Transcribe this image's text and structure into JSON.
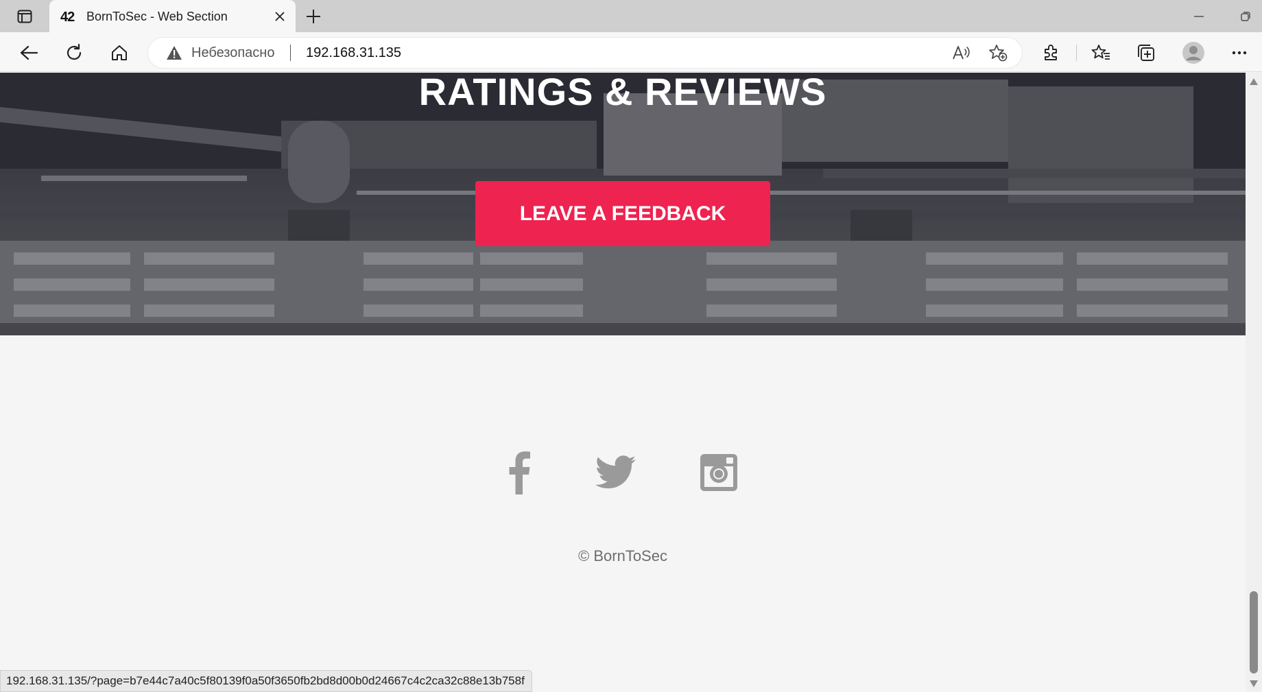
{
  "browser": {
    "tab": {
      "favicon": "42",
      "title": "BornToSec - Web Section"
    },
    "address_bar": {
      "security_label": "Небезопасно",
      "url": "192.168.31.135"
    },
    "status_bar_url": "192.168.31.135/?page=b7e44c7a40c5f80139f0a50f3650fb2bd8d00b0d24667c4c2ca32c88e13b758f",
    "icons": [
      "tab-actions-icon",
      "close-icon",
      "plus-icon",
      "minimize-icon",
      "maximize-icon",
      "back-icon",
      "reload-icon",
      "home-icon",
      "warning-icon",
      "read-aloud-icon",
      "add-favorite-icon",
      "extensions-icon",
      "favorites-icon",
      "collections-icon",
      "profile-icon",
      "more-icon"
    ]
  },
  "page": {
    "hero": {
      "title": "RATINGS & REVIEWS",
      "button_label": "LEAVE A FEEDBACK"
    },
    "socials": [
      "facebook-icon",
      "twitter-icon",
      "instagram-icon"
    ],
    "footer": {
      "copyright": "© BornToSec"
    }
  },
  "colors": {
    "accent": "#ee2350",
    "social_icon": "#9a9a9a",
    "page_bg": "#f5f5f5"
  }
}
